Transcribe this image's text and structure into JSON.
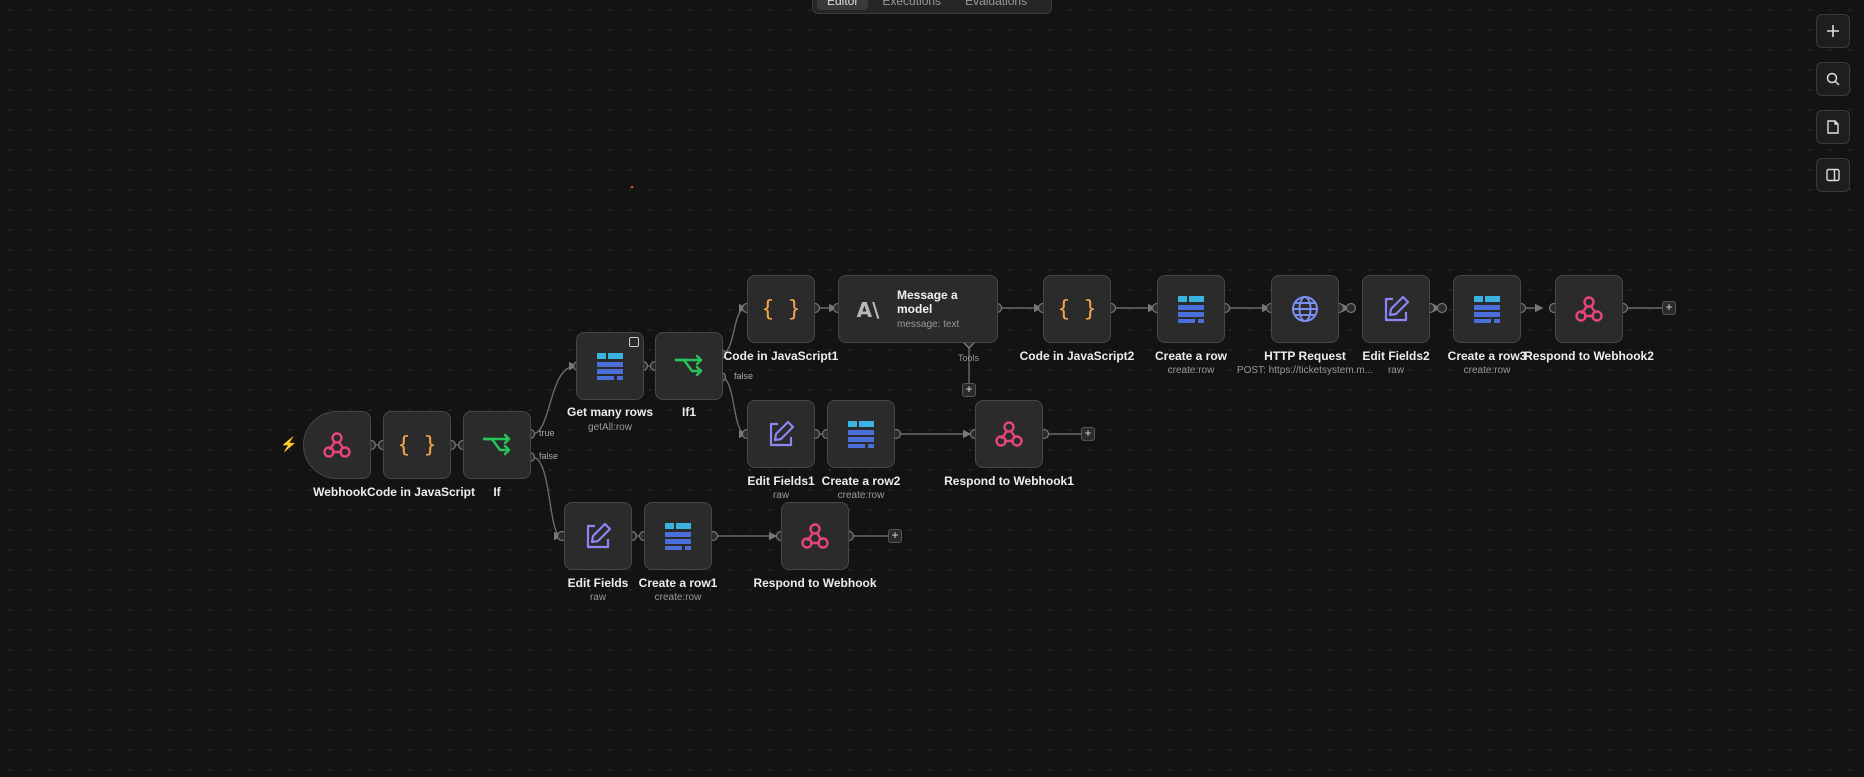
{
  "tabs": [
    "Editor",
    "Executions",
    "Evaluations"
  ],
  "right_toolbar": [
    {
      "name": "add-node-button",
      "icon": "plus-icon"
    },
    {
      "name": "search-nodes-button",
      "icon": "search-icon"
    },
    {
      "name": "sticky-note-button",
      "icon": "sticky-note-icon"
    },
    {
      "name": "toggle-panel-button",
      "icon": "panel-icon"
    }
  ],
  "nodes": [
    {
      "id": "webhook",
      "label": "Webhook",
      "sub": "",
      "icon": "webhook-icon"
    },
    {
      "id": "code-js",
      "label": "Code in JavaScript",
      "sub": "",
      "icon": "code-braces-icon"
    },
    {
      "id": "if",
      "label": "If",
      "sub": "",
      "icon": "if-branch-icon"
    },
    {
      "id": "get-many-rows",
      "label": "Get many rows",
      "sub": "getAll:row",
      "icon": "table-icon"
    },
    {
      "id": "if1",
      "label": "If1",
      "sub": "",
      "icon": "if-branch-icon"
    },
    {
      "id": "code-js1",
      "label": "Code in JavaScript1",
      "sub": "",
      "icon": "code-braces-icon"
    },
    {
      "id": "message-model",
      "label": "Message a model",
      "sub": "message: text",
      "icon": "anthropic-icon"
    },
    {
      "id": "code-js2",
      "label": "Code in JavaScript2",
      "sub": "",
      "icon": "code-braces-icon"
    },
    {
      "id": "create-row",
      "label": "Create a row",
      "sub": "create:row",
      "icon": "table-icon"
    },
    {
      "id": "http-request",
      "label": "HTTP Request",
      "sub": "POST: https://ticketsystem.m...",
      "icon": "globe-icon"
    },
    {
      "id": "edit-fields2",
      "label": "Edit Fields2",
      "sub": "raw",
      "icon": "edit-icon"
    },
    {
      "id": "create-row3",
      "label": "Create a row3",
      "sub": "create:row",
      "icon": "table-icon"
    },
    {
      "id": "respond-webhook2",
      "label": "Respond to Webhook2",
      "sub": "",
      "icon": "webhook-icon"
    },
    {
      "id": "edit-fields1",
      "label": "Edit Fields1",
      "sub": "raw",
      "icon": "edit-icon"
    },
    {
      "id": "create-row2",
      "label": "Create a row2",
      "sub": "create:row",
      "icon": "table-icon"
    },
    {
      "id": "respond-webhook1",
      "label": "Respond to Webhook1",
      "sub": "",
      "icon": "webhook-icon"
    },
    {
      "id": "edit-fields",
      "label": "Edit Fields",
      "sub": "raw",
      "icon": "edit-icon"
    },
    {
      "id": "create-row1",
      "label": "Create a row1",
      "sub": "create:row",
      "icon": "table-icon"
    },
    {
      "id": "respond-webhook",
      "label": "Respond to Webhook",
      "sub": "",
      "icon": "webhook-icon"
    }
  ],
  "branch_labels": {
    "true": "true",
    "false": "false",
    "if1_false": "false"
  },
  "tools_label": "Tools",
  "colors": {
    "webhook": "#e8457a",
    "code": "#f0a44b",
    "if": "#27c45a",
    "table_light": "#3ab3e0",
    "table_dark": "#4a6fd8",
    "edit": "#8b86f2",
    "globe": "#7b8ff0",
    "anthropic": "#b8b8b8",
    "trigger_bolt": "#ff6d2a"
  }
}
